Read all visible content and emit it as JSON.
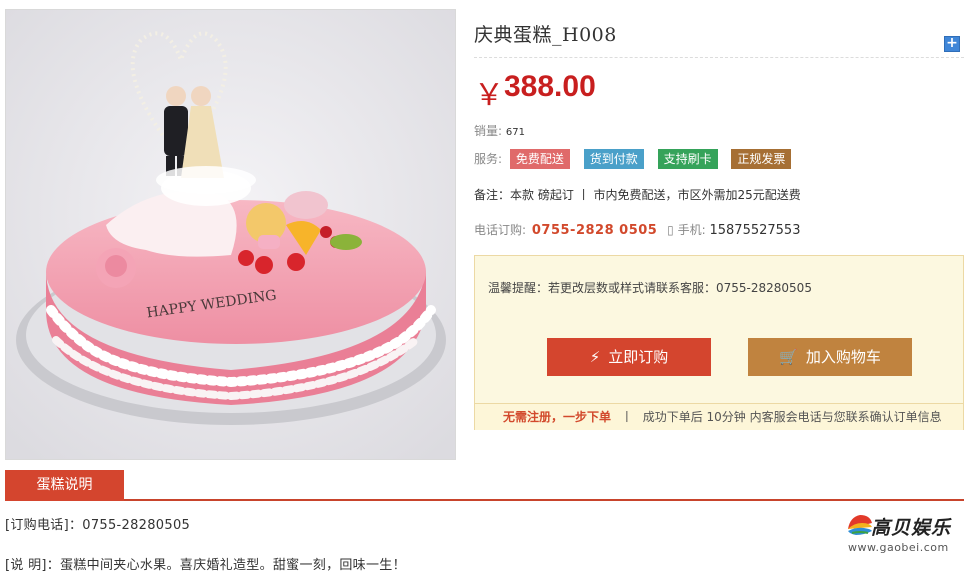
{
  "product": {
    "title": "庆典蛋糕_H008",
    "price_symbol": "￥",
    "price": "388.00",
    "image_caption": "HAPPY WEDDING",
    "sales_label": "销量:",
    "sales_value": "671",
    "services_label": "服务:",
    "services": [
      "免费配送",
      "货到付款",
      "支持刷卡",
      "正规发票"
    ],
    "note": "备注：本款  磅起订 丨 市内免费配送，市区外需加25元配送费",
    "phone_label": "电话订购:",
    "phone_number": "0755-2828 0505",
    "mobile_label": "手机:",
    "mobile_number": "15875527553"
  },
  "order": {
    "tip": "温馨提醒：若更改层数或样式请联系客服：0755-28280505",
    "order_button": "立即订购",
    "cart_button": "加入购物车",
    "foot_highlight": "无需注册，一步下单",
    "foot_sep": "丨",
    "foot_text": "成功下单后 10分钟 内客服会电话与您联系确认订单信息"
  },
  "tabs": {
    "description": "蛋糕说明"
  },
  "description": {
    "line1": "[订购电话]：0755-28280505",
    "line2": "[说  明]：蛋糕中间夹心水果。喜庆婚礼造型。甜蜜一刻，回味一生！"
  },
  "logo": {
    "brand": "高贝娱乐",
    "url": "www.gaobei.com"
  },
  "colors": {
    "accent": "#d4452e",
    "price": "#c81f1f",
    "cart": "#c0833f"
  },
  "icons": {
    "plus": "plus-icon",
    "bolt": "lightning-icon",
    "cart": "cart-icon",
    "phone": "phone-icon"
  }
}
